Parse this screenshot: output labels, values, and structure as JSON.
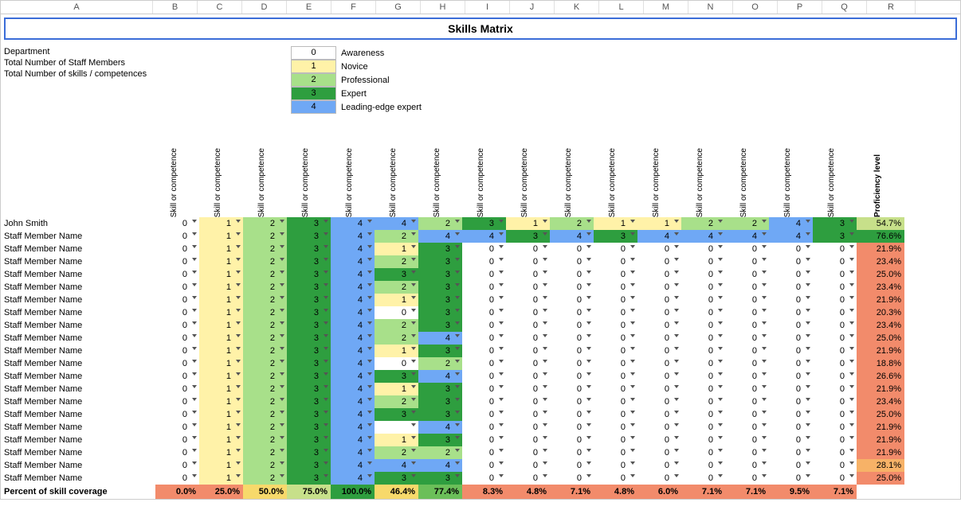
{
  "columns": [
    "A",
    "B",
    "C",
    "D",
    "E",
    "F",
    "G",
    "H",
    "I",
    "J",
    "K",
    "L",
    "M",
    "N",
    "O",
    "P",
    "Q",
    "R"
  ],
  "title": "Skills Matrix",
  "meta_labels": {
    "department": "Department",
    "total_staff": "Total Number of Staff Members",
    "total_skills": "Total Number of skills / competences"
  },
  "legend": [
    {
      "n": "0",
      "label": "Awareness",
      "cls": "lv0"
    },
    {
      "n": "1",
      "label": "Novice",
      "cls": "lv1"
    },
    {
      "n": "2",
      "label": "Professional",
      "cls": "lv2"
    },
    {
      "n": "3",
      "label": "Expert",
      "cls": "lv3"
    },
    {
      "n": "4",
      "label": "Leading-edge expert",
      "cls": "lv4"
    }
  ],
  "skill_header_label": "Skill or competence",
  "proficiency_header": "Proficiency level",
  "rows": [
    {
      "name": "John Smith",
      "cells": [
        0,
        1,
        2,
        3,
        4,
        4,
        2,
        3,
        1,
        2,
        1,
        1,
        2,
        2,
        4,
        3
      ],
      "prof": "54.7%",
      "profCls": "pLime"
    },
    {
      "name": "Staff Member Name",
      "cells": [
        0,
        1,
        2,
        3,
        4,
        2,
        4,
        4,
        3,
        4,
        3,
        4,
        4,
        4,
        4,
        3
      ],
      "prof": "76.6%",
      "profCls": "pDark"
    },
    {
      "name": "Staff Member Name",
      "cells": [
        0,
        1,
        2,
        3,
        4,
        1,
        3,
        0,
        0,
        0,
        0,
        0,
        0,
        0,
        0,
        0
      ],
      "prof": "21.9%",
      "profCls": "pRed"
    },
    {
      "name": "Staff Member Name",
      "cells": [
        0,
        1,
        2,
        3,
        4,
        2,
        3,
        0,
        0,
        0,
        0,
        0,
        0,
        0,
        0,
        0
      ],
      "prof": "23.4%",
      "profCls": "pRed"
    },
    {
      "name": "Staff Member Name",
      "cells": [
        0,
        1,
        2,
        3,
        4,
        3,
        3,
        0,
        0,
        0,
        0,
        0,
        0,
        0,
        0,
        0
      ],
      "prof": "25.0%",
      "profCls": "pRed"
    },
    {
      "name": "Staff Member Name",
      "cells": [
        0,
        1,
        2,
        3,
        4,
        2,
        3,
        0,
        0,
        0,
        0,
        0,
        0,
        0,
        0,
        0
      ],
      "prof": "23.4%",
      "profCls": "pRed"
    },
    {
      "name": "Staff Member Name",
      "cells": [
        0,
        1,
        2,
        3,
        4,
        1,
        3,
        0,
        0,
        0,
        0,
        0,
        0,
        0,
        0,
        0
      ],
      "prof": "21.9%",
      "profCls": "pRed"
    },
    {
      "name": "Staff Member Name",
      "cells": [
        0,
        1,
        2,
        3,
        4,
        0,
        3,
        0,
        0,
        0,
        0,
        0,
        0,
        0,
        0,
        0
      ],
      "prof": "20.3%",
      "profCls": "pRed"
    },
    {
      "name": "Staff Member Name",
      "cells": [
        0,
        1,
        2,
        3,
        4,
        2,
        3,
        0,
        0,
        0,
        0,
        0,
        0,
        0,
        0,
        0
      ],
      "prof": "23.4%",
      "profCls": "pRed"
    },
    {
      "name": "Staff Member Name",
      "cells": [
        0,
        1,
        2,
        3,
        4,
        2,
        4,
        0,
        0,
        0,
        0,
        0,
        0,
        0,
        0,
        0
      ],
      "prof": "25.0%",
      "profCls": "pRed"
    },
    {
      "name": "Staff Member Name",
      "cells": [
        0,
        1,
        2,
        3,
        4,
        1,
        3,
        0,
        0,
        0,
        0,
        0,
        0,
        0,
        0,
        0
      ],
      "prof": "21.9%",
      "profCls": "pRed"
    },
    {
      "name": "Staff Member Name",
      "cells": [
        0,
        1,
        2,
        3,
        4,
        0,
        2,
        0,
        0,
        0,
        0,
        0,
        0,
        0,
        0,
        0
      ],
      "prof": "18.8%",
      "profCls": "pRed"
    },
    {
      "name": "Staff Member Name",
      "cells": [
        0,
        1,
        2,
        3,
        4,
        3,
        4,
        0,
        0,
        0,
        0,
        0,
        0,
        0,
        0,
        0
      ],
      "prof": "26.6%",
      "profCls": "pRed"
    },
    {
      "name": "Staff Member Name",
      "cells": [
        0,
        1,
        2,
        3,
        4,
        1,
        3,
        0,
        0,
        0,
        0,
        0,
        0,
        0,
        0,
        0
      ],
      "prof": "21.9%",
      "profCls": "pRed"
    },
    {
      "name": "Staff Member Name",
      "cells": [
        0,
        1,
        2,
        3,
        4,
        2,
        3,
        0,
        0,
        0,
        0,
        0,
        0,
        0,
        0,
        0
      ],
      "prof": "23.4%",
      "profCls": "pRed"
    },
    {
      "name": "Staff Member Name",
      "cells": [
        0,
        1,
        2,
        3,
        4,
        3,
        3,
        0,
        0,
        0,
        0,
        0,
        0,
        0,
        0,
        0
      ],
      "prof": "25.0%",
      "profCls": "pRed"
    },
    {
      "name": "Staff Member Name",
      "cells": [
        0,
        1,
        2,
        3,
        4,
        null,
        4,
        0,
        0,
        0,
        0,
        0,
        0,
        0,
        0,
        0
      ],
      "prof": "21.9%",
      "profCls": "pRed"
    },
    {
      "name": "Staff Member Name",
      "cells": [
        0,
        1,
        2,
        3,
        4,
        1,
        3,
        0,
        0,
        0,
        0,
        0,
        0,
        0,
        0,
        0
      ],
      "prof": "21.9%",
      "profCls": "pRed"
    },
    {
      "name": "Staff Member Name",
      "cells": [
        0,
        1,
        2,
        3,
        4,
        2,
        2,
        0,
        0,
        0,
        0,
        0,
        0,
        0,
        0,
        0
      ],
      "prof": "21.9%",
      "profCls": "pRed"
    },
    {
      "name": "Staff Member Name",
      "cells": [
        0,
        1,
        2,
        3,
        4,
        4,
        4,
        0,
        0,
        0,
        0,
        0,
        0,
        0,
        0,
        0
      ],
      "prof": "28.1%",
      "profCls": "pOrange"
    },
    {
      "name": "Staff Member Name",
      "cells": [
        0,
        1,
        2,
        3,
        4,
        3,
        3,
        0,
        0,
        0,
        0,
        0,
        0,
        0,
        0,
        0
      ],
      "prof": "25.0%",
      "profCls": "pRed"
    }
  ],
  "footer": {
    "label": "Percent of skill coverage",
    "values": [
      "0.0%",
      "25.0%",
      "50.0%",
      "75.0%",
      "100.0%",
      "46.4%",
      "77.4%",
      "8.3%",
      "4.8%",
      "7.1%",
      "4.8%",
      "6.0%",
      "7.1%",
      "7.1%",
      "9.5%",
      "7.1%"
    ],
    "cls": [
      "pRed",
      "pRed",
      "pYellow",
      "pLime",
      "pDark",
      "pYellow",
      "pGreen",
      "pRed",
      "pRed",
      "pRed",
      "pRed",
      "pRed",
      "pRed",
      "pRed",
      "pRed",
      "pRed"
    ]
  }
}
